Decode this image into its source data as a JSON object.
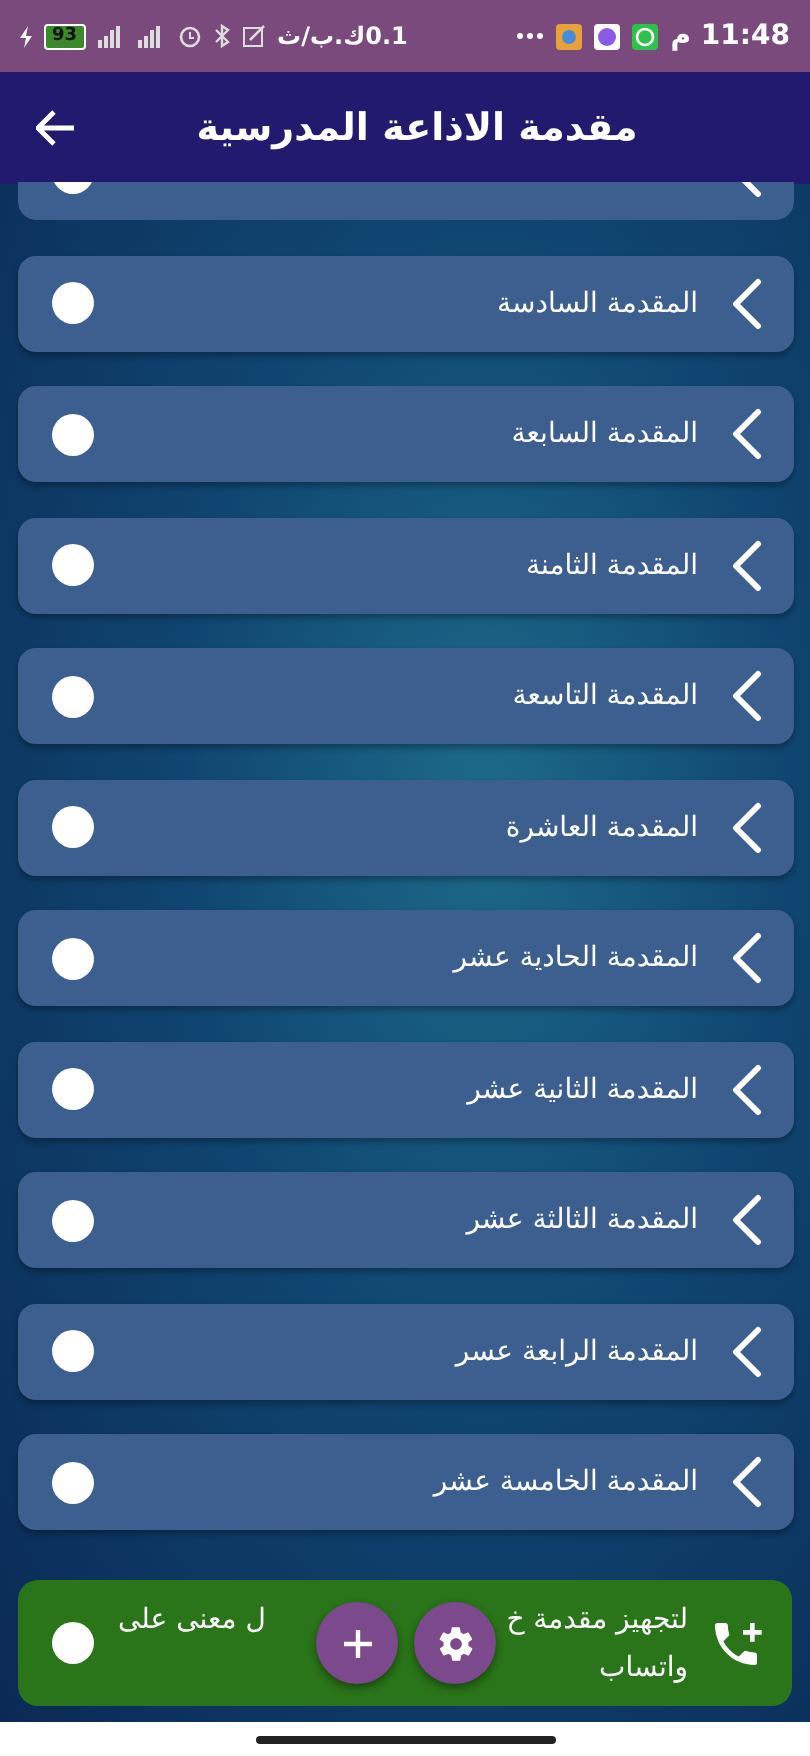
{
  "status_bar": {
    "battery": "93",
    "speed": "0.1ك.ب/ث",
    "time": "11:48 م"
  },
  "header": {
    "title": "مقدمة الاذاعة المدرسية"
  },
  "items": [
    {
      "title": "المقدمة السادسة"
    },
    {
      "title": "المقدمة السابعة"
    },
    {
      "title": "المقدمة الثامنة"
    },
    {
      "title": "المقدمة التاسعة"
    },
    {
      "title": "المقدمة العاشرة"
    },
    {
      "title": "المقدمة الحادية عشر"
    },
    {
      "title": "المقدمة الثانية عشر"
    },
    {
      "title": "المقدمة الثالثة عشر"
    },
    {
      "title": "المقدمة الرابعة عسر"
    },
    {
      "title": "المقدمة الخامسة عشر"
    }
  ],
  "banner": {
    "line_1_right": "لتجهيز مقدمة خ",
    "line_1_left": "ل معنى على",
    "line_2": "واتساب"
  }
}
